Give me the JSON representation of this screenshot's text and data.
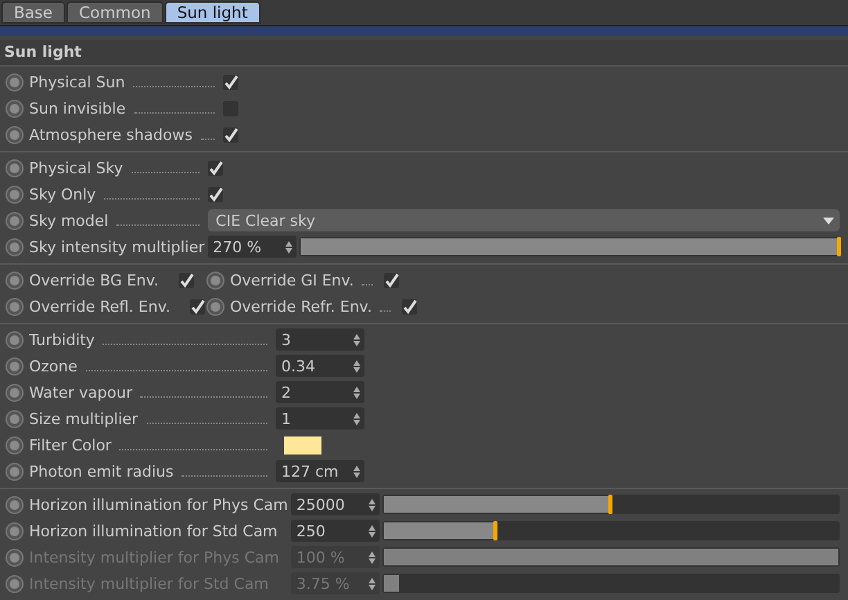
{
  "tabs": [
    {
      "label": "Base",
      "selected": false
    },
    {
      "label": "Common",
      "selected": false
    },
    {
      "label": "Sun light",
      "selected": true
    }
  ],
  "header": "Sun light",
  "sections": [
    {
      "rows": [
        {
          "kind": "checkbox",
          "label": "Physical Sun",
          "checked": true
        },
        {
          "kind": "checkbox",
          "label": "Sun invisible",
          "checked": false
        },
        {
          "kind": "checkbox",
          "label": "Atmosphere shadows",
          "checked": true
        }
      ]
    },
    {
      "rows": [
        {
          "kind": "checkbox",
          "label": "Physical Sky",
          "checked": true
        },
        {
          "kind": "checkbox",
          "label": "Sky Only",
          "checked": true
        },
        {
          "kind": "dropdown",
          "label": "Sky model",
          "value": "CIE Clear sky"
        },
        {
          "kind": "slider",
          "label": "Sky intensity multiplier",
          "value": "270 %",
          "level": 1,
          "enabled": true
        }
      ]
    },
    {
      "rows": [
        {
          "kind": "pair",
          "items": [
            {
              "label": "Override BG Env.",
              "checked": true
            },
            {
              "label": "Override GI Env.",
              "checked": true
            }
          ]
        },
        {
          "kind": "pair",
          "items": [
            {
              "label": "Override Refl. Env.",
              "checked": true
            },
            {
              "label": "Override Refr. Env.",
              "checked": true
            }
          ]
        }
      ]
    },
    {
      "rows": [
        {
          "kind": "number",
          "label": "Turbidity",
          "value": "3"
        },
        {
          "kind": "number",
          "label": "Ozone",
          "value": "0.34"
        },
        {
          "kind": "number",
          "label": "Water vapour",
          "value": "2"
        },
        {
          "kind": "number",
          "label": "Size multiplier",
          "value": "1"
        },
        {
          "kind": "color",
          "label": "Filter Color",
          "color": "#ffe79a"
        },
        {
          "kind": "number",
          "label": "Photon emit radius",
          "value": "127 cm"
        }
      ]
    },
    {
      "rows": [
        {
          "kind": "slider",
          "label": "Horizon illumination for Phys Cam",
          "value": "25000",
          "level": 0.5,
          "enabled": true
        },
        {
          "kind": "slider",
          "label": "Horizon illumination for Std Cam",
          "value": "250",
          "level": 0.25,
          "enabled": true
        },
        {
          "kind": "slider",
          "label": "Intensity multiplier for Phys Cam",
          "value": "100 %",
          "level": 1,
          "enabled": false
        },
        {
          "kind": "slider",
          "label": "Intensity multiplier for Std Cam",
          "value": "3.75 %",
          "level": 0.035,
          "enabled": false
        }
      ]
    }
  ]
}
